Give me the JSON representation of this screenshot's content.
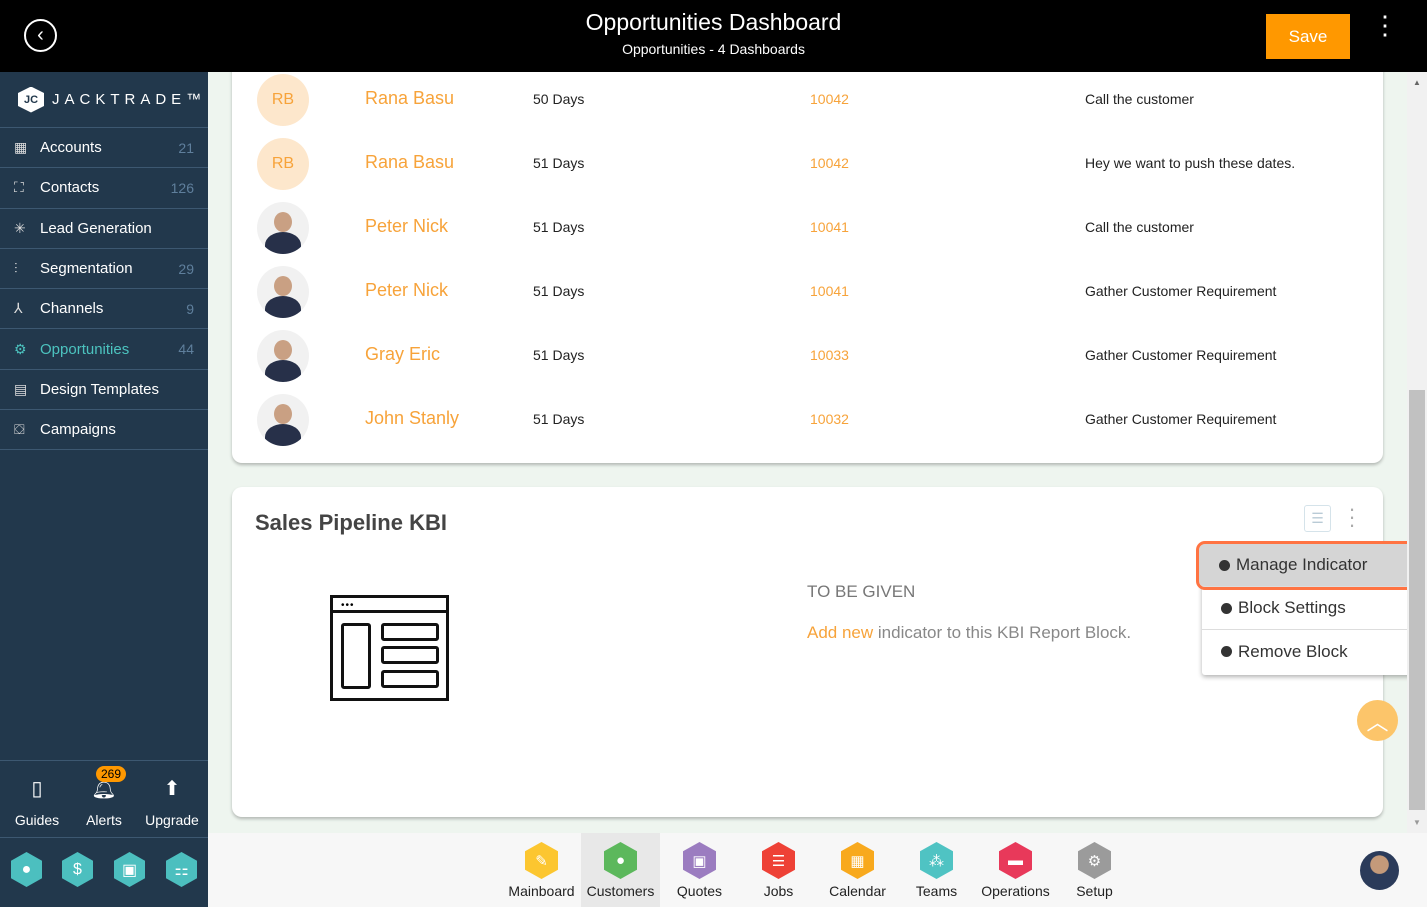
{
  "header": {
    "title": "Opportunities Dashboard",
    "subtitle": "Opportunities - 4 Dashboards",
    "save_label": "Save"
  },
  "sidebar": {
    "brand": "JACKTRADE™",
    "items": [
      {
        "label": "Accounts",
        "count": "21",
        "icon": "building-icon"
      },
      {
        "label": "Contacts",
        "count": "126",
        "icon": "contacts-icon"
      },
      {
        "label": "Lead Generation",
        "count": "",
        "icon": "lead-icon"
      },
      {
        "label": "Segmentation",
        "count": "29",
        "icon": "segmentation-icon"
      },
      {
        "label": "Channels",
        "count": "9",
        "icon": "channels-icon"
      },
      {
        "label": "Opportunities",
        "count": "44",
        "icon": "opportunities-icon",
        "active": true
      },
      {
        "label": "Design Templates",
        "count": "",
        "icon": "templates-icon"
      },
      {
        "label": "Campaigns",
        "count": "",
        "icon": "campaigns-icon"
      }
    ],
    "utilities": [
      {
        "label": "Guides"
      },
      {
        "label": "Alerts",
        "badge": "269"
      },
      {
        "label": "Upgrade"
      }
    ],
    "quick_icons": [
      "person-icon",
      "dollar-icon",
      "money-icon",
      "workflow-icon"
    ]
  },
  "table": {
    "rows": [
      {
        "initials": "RB",
        "name": "Rana Basu",
        "days": "50 Days",
        "id": "10042",
        "note": "Call the customer"
      },
      {
        "initials": "RB",
        "name": "Rana Basu",
        "days": "51 Days",
        "id": "10042",
        "note": "Hey we want to push these dates."
      },
      {
        "initials": "",
        "name": "Peter Nick",
        "days": "51 Days",
        "id": "10041",
        "note": "Call the customer"
      },
      {
        "initials": "",
        "name": "Peter Nick",
        "days": "51 Days",
        "id": "10041",
        "note": "Gather Customer Requirement"
      },
      {
        "initials": "",
        "name": "Gray Eric",
        "days": "51 Days",
        "id": "10033",
        "note": "Gather Customer Requirement"
      },
      {
        "initials": "",
        "name": "John Stanly",
        "days": "51 Days",
        "id": "10032",
        "note": "Gather Customer Requirement"
      }
    ]
  },
  "kbi": {
    "title": "Sales Pipeline KBI",
    "status": "TO BE GIVEN",
    "add_link": "Add new",
    "add_rest": " indicator to this KBI Report Block."
  },
  "menu": {
    "items": [
      "Manage Indicator",
      "Block Settings",
      "Remove Block"
    ]
  },
  "apps": [
    {
      "label": "Mainboard",
      "color": "#fcc630"
    },
    {
      "label": "Customers",
      "color": "#5cb85c",
      "active": true
    },
    {
      "label": "Quotes",
      "color": "#9b7cc0"
    },
    {
      "label": "Jobs",
      "color": "#ee4136"
    },
    {
      "label": "Calendar",
      "color": "#f8a91d"
    },
    {
      "label": "Teams",
      "color": "#4fc3c3"
    },
    {
      "label": "Operations",
      "color": "#e8395a"
    },
    {
      "label": "Setup",
      "color": "#9b9b9b"
    }
  ]
}
